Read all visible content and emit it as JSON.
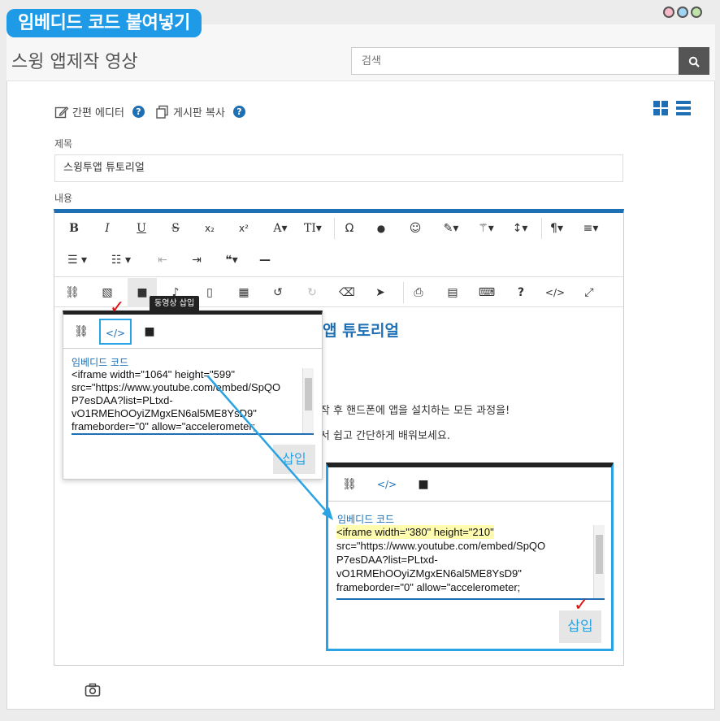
{
  "badge": "임베디드 코드 붙여넣기",
  "colors": {
    "accent": "#1e6fb4",
    "highlight": "#29a3e3",
    "badge": "#1e9ae6",
    "check": "#dd1111"
  },
  "window_dots": [
    "#f7b9c8",
    "#9fd4f2",
    "#bfe3a8"
  ],
  "page_title": "스윙 앱제작 영상",
  "search": {
    "placeholder": "검색",
    "button_icon": "search-icon"
  },
  "links": {
    "simple_editor": "간편 에디터",
    "board_copy": "게시판 복사"
  },
  "view_icons": [
    "grid-view-icon",
    "list-view-icon"
  ],
  "form": {
    "title_label": "제목",
    "title_value": "스윙투앱 튜토리얼",
    "content_label": "내용"
  },
  "toolbar": {
    "row1": [
      "B",
      "I",
      "U",
      "S",
      "x₂",
      "x²",
      "A▾",
      "TI▾",
      "Ω",
      "💧",
      "☺",
      "brush▾",
      "wand▾",
      "↕▾"
    ],
    "row1_glyphs": {
      "bold": "B",
      "italic": "I",
      "underline": "U",
      "strike": "S",
      "sub": "x₂",
      "sup": "x²",
      "font": "A",
      "size": "TI",
      "omega": "Ω",
      "drop": "●",
      "smile": "☺",
      "para": "¶",
      "align": "≡"
    },
    "tooltip": "동영상 삽입"
  },
  "content": {
    "heading": "앱 튜토리얼",
    "line1": "앱제작 후 핸드폰에 앱을 설치하는 모든 과정을!",
    "line2": "통해서 쉽고 간단하게 배워보세요."
  },
  "popup_small": {
    "label": "임베디드 코드",
    "lines": [
      "<iframe width=\"1064\" height=\"599\"",
      "src=\"https://www.youtube.com/embed/SpQO",
      "P7esDAA?list=PLtxd-",
      "vO1RMEhOOyiZMgxEN6al5ME8YsD9\"",
      "frameborder=\"0\" allow=\"accelerometer;"
    ],
    "insert": "삽입"
  },
  "popup_large": {
    "label": "임베디드 코드",
    "highlight_line": "<iframe width=\"380\" height=\"210\"",
    "lines": [
      "src=\"https://www.youtube.com/embed/SpQO",
      "P7esDAA?list=PLtxd-",
      "vO1RMEhOOyiZMgxEN6al5ME8YsD9\"",
      "frameborder=\"0\" allow=\"accelerometer;"
    ],
    "insert": "삽입"
  }
}
